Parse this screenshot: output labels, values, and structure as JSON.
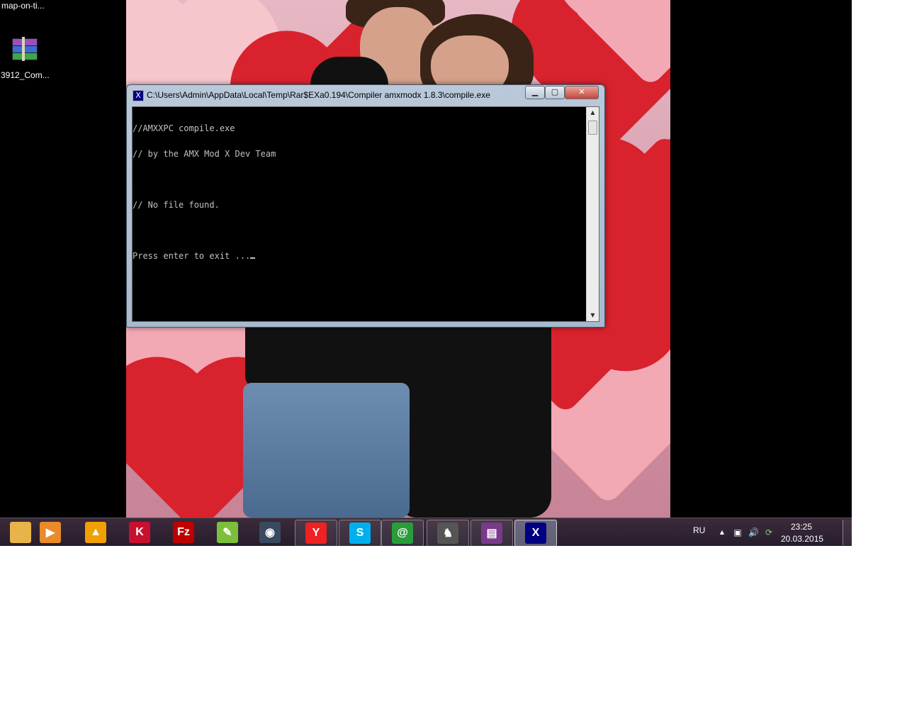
{
  "desktop": {
    "icons": [
      {
        "label": "map-on-ti...",
        "icon": "file-icon"
      },
      {
        "label": "3912_Com...",
        "icon": "winrar-archive-icon"
      }
    ]
  },
  "console_window": {
    "title": "C:\\Users\\Admin\\AppData\\Local\\Temp\\Rar$EXa0.194\\Compiler amxmodx 1.8.3\\compile.exe",
    "title_icon": "X",
    "minimize_symbol": "▁",
    "maximize_symbol": "▢",
    "close_symbol": "✕",
    "lines": [
      "//AMXXPC compile.exe",
      "// by the AMX Mod X Dev Team",
      "",
      "// No file found.",
      "",
      "Press enter to exit ..."
    ],
    "scroll_up": "▲",
    "scroll_down": "▼"
  },
  "taskbar": {
    "items": [
      {
        "icon": "windows-explorer-icon",
        "glyph": "",
        "color": "#e8b44a",
        "state": "pinned"
      },
      {
        "icon": "media-player-icon",
        "glyph": "▶",
        "color": "#e98a2b",
        "state": "pinned"
      },
      {
        "icon": "aimp-icon",
        "glyph": "▲",
        "color": "#f0a000",
        "state": "pinned"
      },
      {
        "icon": "kaspersky-icon",
        "glyph": "K",
        "color": "#c8102e",
        "state": "pinned"
      },
      {
        "icon": "filezilla-icon",
        "glyph": "Fz",
        "color": "#bf0000",
        "state": "pinned"
      },
      {
        "icon": "notepad-plus-icon",
        "glyph": "✎",
        "color": "#7cbf3a",
        "state": "pinned"
      },
      {
        "icon": "steam-icon",
        "glyph": "◉",
        "color": "#3a4a5e",
        "state": "pinned"
      },
      {
        "icon": "yandex-browser-icon",
        "glyph": "Y",
        "color": "#e22",
        "state": "running"
      },
      {
        "icon": "skype-icon",
        "glyph": "S",
        "color": "#00aff0",
        "state": "running"
      },
      {
        "icon": "mail-agent-icon",
        "glyph": "@",
        "color": "#2a9d3a",
        "state": "running"
      },
      {
        "icon": "counter-strike-icon",
        "glyph": "♞",
        "color": "#555",
        "state": "running"
      },
      {
        "icon": "winrar-icon",
        "glyph": "▤",
        "color": "#7a3a8a",
        "state": "running"
      },
      {
        "icon": "amxx-compiler-icon",
        "glyph": "X",
        "color": "#000080",
        "state": "active"
      }
    ],
    "tray": {
      "language": "RU",
      "show_hidden_symbol": "▲",
      "network_symbol": "▣",
      "volume_symbol": "🔊",
      "sync_symbol": "⟳",
      "time": "23:25",
      "date": "20.03.2015"
    }
  }
}
